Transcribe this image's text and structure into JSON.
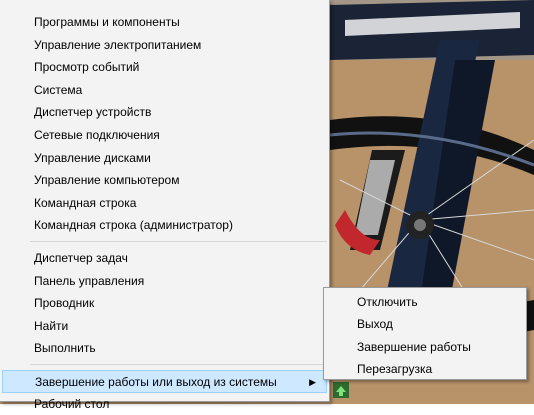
{
  "main_menu": {
    "groups": [
      {
        "items": [
          {
            "label": "Программы и компоненты"
          },
          {
            "label": "Управление электропитанием"
          },
          {
            "label": "Просмотр событий"
          },
          {
            "label": "Система"
          },
          {
            "label": "Диспетчер устройств"
          },
          {
            "label": "Сетевые подключения"
          },
          {
            "label": "Управление дисками"
          },
          {
            "label": "Управление компьютером"
          },
          {
            "label": "Командная строка"
          },
          {
            "label": "Командная строка (администратор)"
          }
        ]
      },
      {
        "items": [
          {
            "label": "Диспетчер задач"
          },
          {
            "label": "Панель управления"
          },
          {
            "label": "Проводник"
          },
          {
            "label": "Найти"
          },
          {
            "label": "Выполнить"
          }
        ]
      },
      {
        "items": [
          {
            "label": "Завершение работы или выход из системы",
            "submenu_arrow": "▶"
          },
          {
            "label": "Рабочий стол"
          }
        ]
      }
    ]
  },
  "submenu": {
    "items": [
      {
        "label": "Отключить"
      },
      {
        "label": "Выход"
      },
      {
        "label": "Завершение работы"
      },
      {
        "label": "Перезагрузка"
      }
    ]
  },
  "colors": {
    "menu_background": "#f3f3f3",
    "highlight_background": "#cde8ff",
    "highlight_border": "#99d1ff",
    "separator": "#d7d7d7"
  },
  "icons": {
    "submenu_arrow": "chevron-right-icon",
    "taskbar": "green-arrow-icon"
  }
}
